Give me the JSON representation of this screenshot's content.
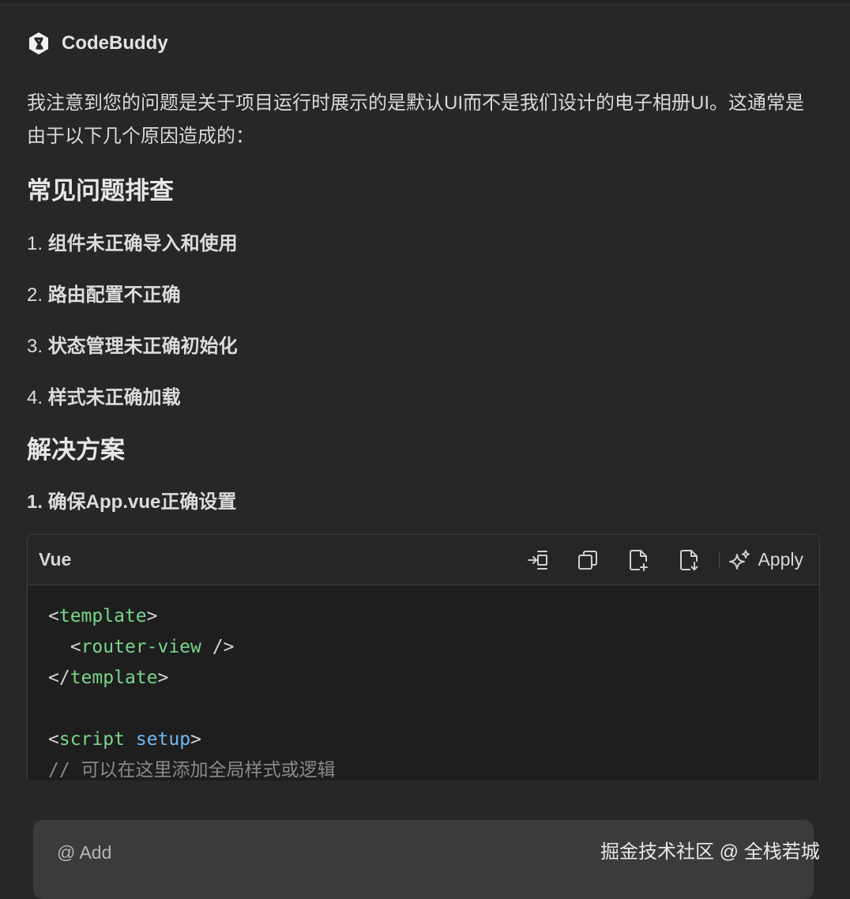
{
  "app": {
    "name": "CodeBuddy"
  },
  "message": {
    "intro": "我注意到您的问题是关于项目运行时展示的是默认UI而不是我们设计的电子相册UI。这通常是由于以下几个原因造成的：",
    "section1_title": "常见问题排查",
    "issues": [
      {
        "num": "1.",
        "text": "组件未正确导入和使用"
      },
      {
        "num": "2.",
        "text": "路由配置不正确"
      },
      {
        "num": "3.",
        "text": "状态管理未正确初始化"
      },
      {
        "num": "4.",
        "text": "样式未正确加载"
      }
    ],
    "section2_title": "解决方案",
    "step1": "1. 确保App.vue正确设置"
  },
  "code_block": {
    "language": "Vue",
    "toolbar": {
      "insert_icon": "insert-at-cursor-icon",
      "copy_icon": "copy-icon",
      "new_file_icon": "new-file-icon",
      "save_file_icon": "save-to-file-icon",
      "apply_icon": "sparkle-icon",
      "apply_label": "Apply"
    },
    "lines": [
      {
        "open": "<",
        "tag": "template",
        "close": ">"
      },
      {
        "indent": "  ",
        "open": "<",
        "tag": "router-view",
        "close": " />"
      },
      {
        "open": "</",
        "tag": "template",
        "close": ">"
      },
      {
        "blank": true
      },
      {
        "open": "<",
        "tag": "script",
        "attr": "setup",
        "close": ">"
      },
      {
        "comment": "// 可以在这里添加全局样式或逻辑"
      }
    ]
  },
  "input": {
    "add_label": "@ Add"
  },
  "watermark": "掘金技术社区 @ 全栈若城",
  "colors": {
    "background": "#272727",
    "code_background": "#1e1e1e",
    "tag_green": "#79d58a",
    "attr_blue": "#73b8f0"
  }
}
